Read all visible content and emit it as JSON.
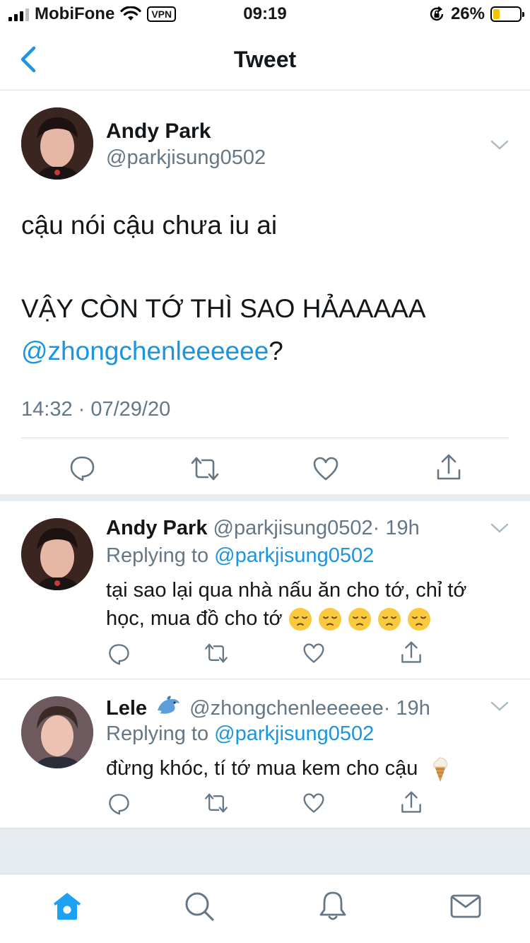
{
  "status_bar": {
    "carrier": "MobiFone",
    "vpn": "VPN",
    "time": "09:19",
    "battery": "26%",
    "battery_level": 0.26
  },
  "nav": {
    "title": "Tweet",
    "back_icon": "chevron-left-icon"
  },
  "main_tweet": {
    "name": "Andy Park",
    "handle": "@parkjisung0502",
    "line1": "cậu nói cậu chưa iu ai",
    "line2": "VẬY CÒN TỚ THÌ SAO HẢAAAAA",
    "mention": "@zhongchenleeeeee",
    "mention_suffix": "?",
    "timestamp": "14:32 · 07/29/20"
  },
  "replies": [
    {
      "name": "Andy Park",
      "handle": "@parkjisung0502",
      "time": "· 19h",
      "replying_prefix": "Replying to",
      "replying_to": "@parkjisung0502",
      "text_line1": "tại sao lại qua nhà nấu ăn cho tớ, chỉ tớ",
      "text_line2": "học, mua đồ cho tớ"
    },
    {
      "name": "Lele",
      "handle": "@zhongchenleeeeee",
      "time": "· 19h",
      "replying_prefix": "Replying to",
      "replying_to": "@parkjisung0502",
      "text_line1": "đừng khóc, tí tớ mua kem cho cậu"
    }
  ],
  "colors": {
    "accent": "#1b95e0",
    "secondary_text": "#657786",
    "divider": "#e6ecf0"
  },
  "tabbar": [
    "home-icon",
    "search-icon",
    "bell-icon",
    "mail-icon"
  ]
}
